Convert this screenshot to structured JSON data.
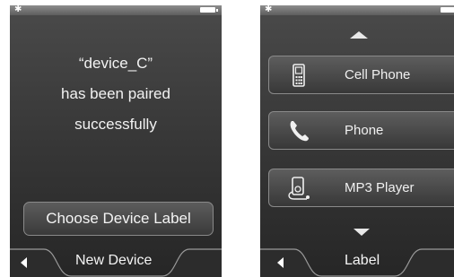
{
  "left_screen": {
    "message_lines": [
      "“device_C”",
      "has been paired",
      "successfully"
    ],
    "button_label": "Choose Device Label",
    "footer_title": "New Device"
  },
  "right_screen": {
    "items": [
      {
        "label": "Cell Phone",
        "icon": "cell-phone-icon"
      },
      {
        "label": "Phone",
        "icon": "phone-handset-icon"
      },
      {
        "label": "MP3 Player",
        "icon": "mp3-player-icon"
      }
    ],
    "footer_title": "Label"
  },
  "colors": {
    "screen_top": "#4a4a4a",
    "screen_bottom": "#262626",
    "text": "#f2f2f2",
    "statusbar": "#7a7a7a"
  }
}
